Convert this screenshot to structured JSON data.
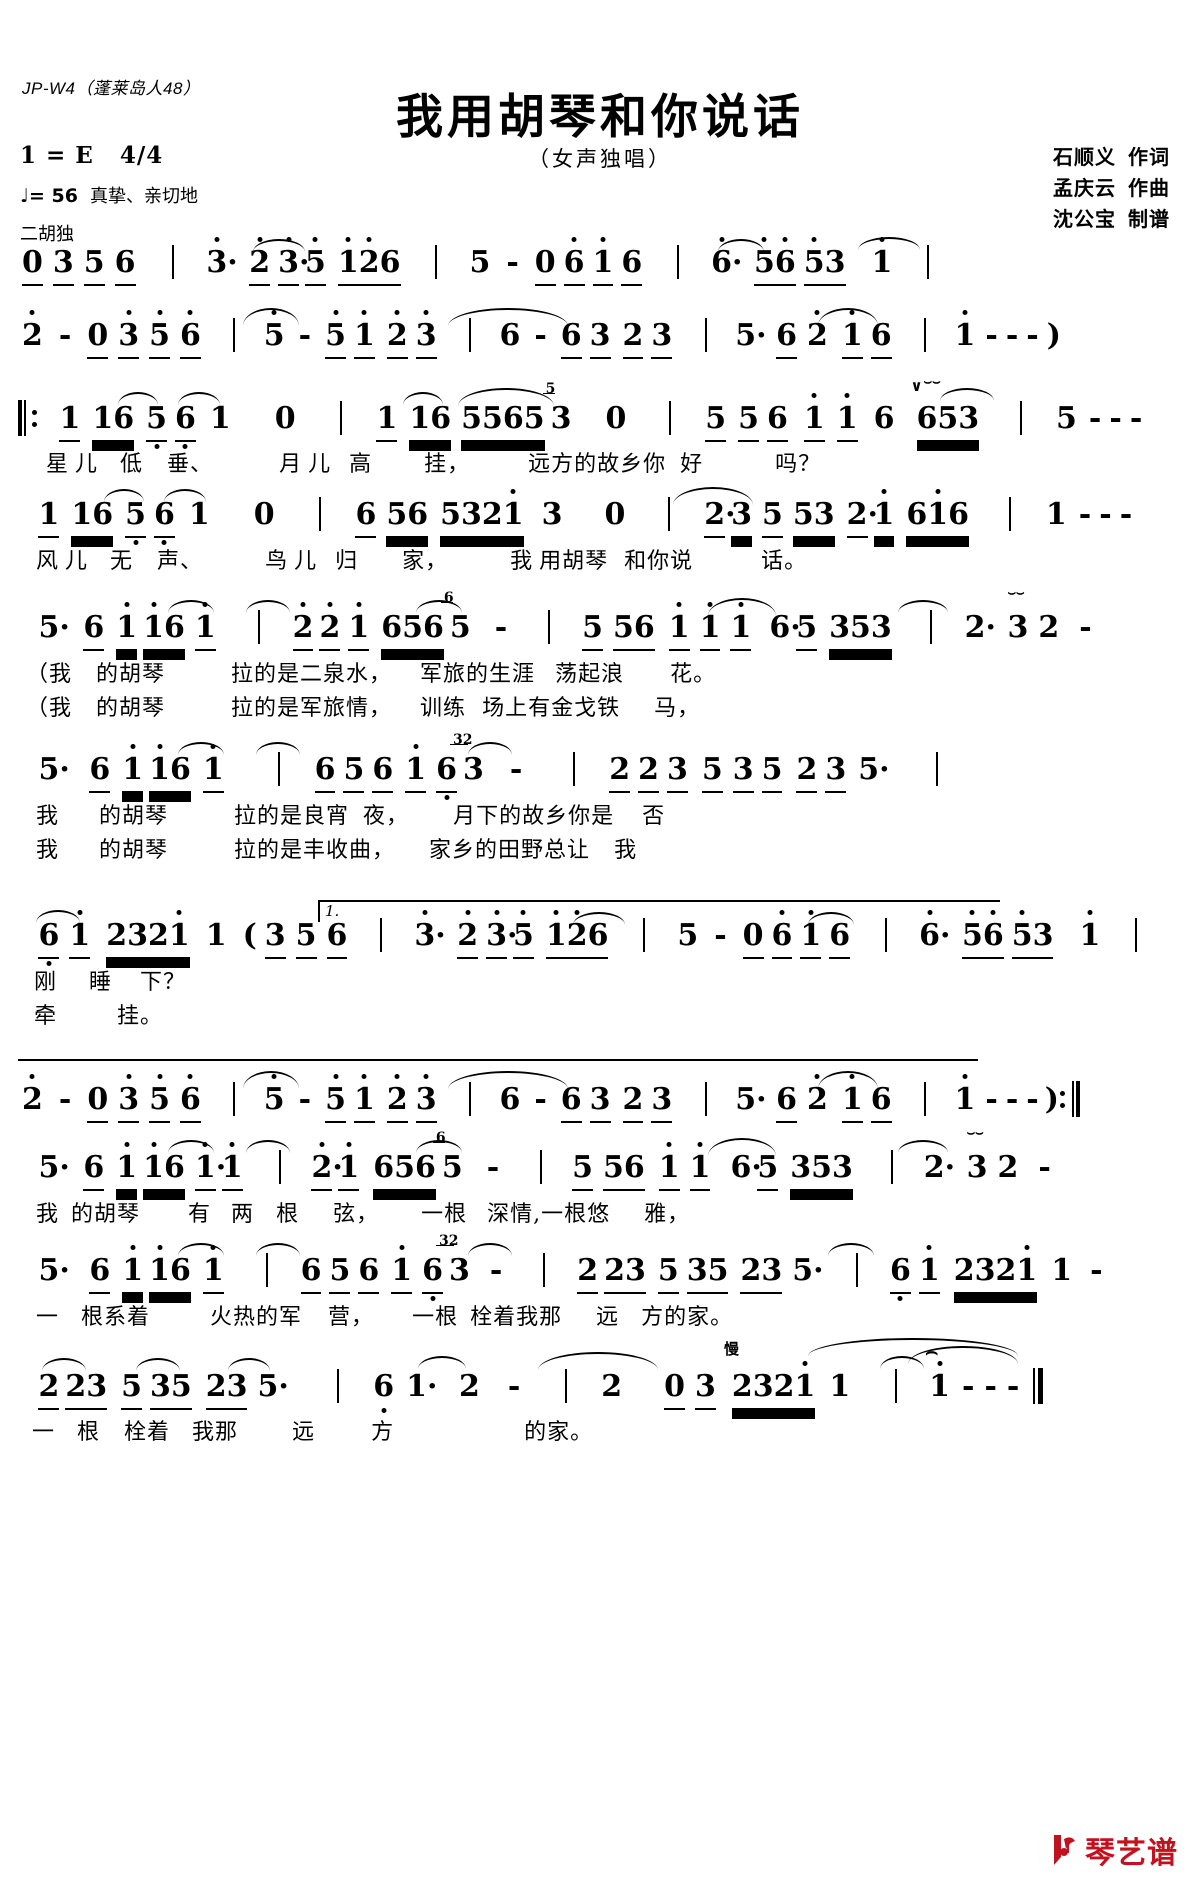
{
  "header": {
    "catalog": "JP-W4（蓬莱岛人48）",
    "title": "我用胡琴和你说话",
    "subtitle": "（女声独唱）",
    "key_label": "1 = E",
    "meter": "4/4",
    "tempo_value": "= 56",
    "tempo_note_glyph": "♩",
    "mood": "真挚、亲切地",
    "instrument_cue": "二胡独",
    "credits": [
      {
        "name": "石顺义",
        "role": "作词"
      },
      {
        "name": "孟庆云",
        "role": "作曲"
      },
      {
        "name": "沈公宝",
        "role": "制谱"
      }
    ]
  },
  "footer": {
    "logo_text": "琴艺谱",
    "logo_color": "#c1121f"
  },
  "chart_data": {
    "type": "table",
    "title": "我用胡琴和你说话 — 简谱 (jianpu numbered notation)",
    "key": "1 = E",
    "time_signature": "4/4",
    "tempo_bpm": 56,
    "voice": "女声独唱",
    "systems": [
      {
        "id": "intro-1",
        "label": "二胡独 (erhu solo intro)",
        "measures": [
          "0 3 5 6",
          "3· 2 3·5 1 2 6",
          "5 - 0 6 1 6",
          "6· 5 6 5 3  1"
        ],
        "lyrics": []
      },
      {
        "id": "intro-2",
        "measures": [
          "2 - 0 3 5 6",
          "5 - 5 1 2 3",
          "6 - 6 3 2 3",
          "5· 6 2 1 6",
          "1 - - - )"
        ],
        "lyrics": []
      },
      {
        "id": "verse-1a",
        "repeat_open": true,
        "measures": [
          "1 1 6 5 6 1  0",
          "1 1 6 5 5 6 5 (5)3  0",
          "5 5 6 1 1 6  6 5 3",
          "5 - - -"
        ],
        "lyrics": [
          "星儿 低 垂、 月儿 高 挂， 远方的故乡你 好 吗？"
        ]
      },
      {
        "id": "verse-1b",
        "measures": [
          "1 1 6 5 6 1  0",
          "6 5 6 5 3 2 1  3  0",
          "2·3 5 5 3 2·1 6 1 6",
          "1 - - -"
        ],
        "lyrics": [
          "风儿 无 声、 鸟儿 归 家， 我用胡琴 和你说 话。"
        ]
      },
      {
        "id": "verse-2",
        "measures": [
          "5· 6 1 1 6 1",
          "2 2 1 6 5 6 (6)5 -",
          "5 5 6 1 1 1 6·5 3 5 3",
          "2· 3 2 -"
        ],
        "lyrics": [
          "我 的胡琴 拉的是二泉水， 军旅的生涯 荡起浪 花。",
          "我 的胡琴 拉的是军旅情， 训练 场上有金戈铁 马，"
        ]
      },
      {
        "id": "verse-3",
        "measures": [
          "5· 6 1 1 6 1",
          "6 5 6 1 6 (32)3 -",
          "2 2 3 5 3 5 2 3 5·"
        ],
        "lyrics": [
          "我 的胡琴 拉的是良宵 夜， 月下的故乡你是 否",
          "我 的胡琴 拉的是丰收曲， 家乡的田野总让 我"
        ]
      },
      {
        "id": "verse-4-volta1",
        "volta": "1.",
        "measures": [
          "6 1 2 3 2 1 1 ( 3 5 6",
          "3· 2 3·5 1 2 6",
          "5 - 0 6 1 6",
          "6· 5 6 5 3  1"
        ],
        "lyrics": [
          "刚 睡 下？",
          "牵 挂。"
        ]
      },
      {
        "id": "volta1-end",
        "measures": [
          "2 - 0 3 5 6",
          "5 - 5 1 2 3",
          "6 - 6 3 2 3",
          "5· 6 2 1 6",
          "1 - - - )"
        ],
        "repeat_close": true,
        "lyrics": []
      },
      {
        "id": "chorus-1",
        "measures": [
          "5· 6 1 1 6 1·1",
          "2·1 6 5 6 (6)5 -",
          "5 5 6 1 1 6·5 3 5 3",
          "2· 3 2 -"
        ],
        "lyrics": [
          "我 的胡琴 有 两 根 弦， 一根 深情，一根悠 雅，"
        ]
      },
      {
        "id": "chorus-2",
        "measures": [
          "5· 6 1 1 6 1",
          "6 5 6 1 6 (32)3 -",
          "2 2 3 5 3 5 2 3 5·",
          "6 1 2 3 2 1 1 -"
        ],
        "lyrics": [
          "一 根系着 火热的军 营， 一根 栓着我那 远 方的家。"
        ]
      },
      {
        "id": "chorus-3",
        "tempo_change": "慢",
        "measures": [
          "2 2 3 5 3 5 2 3 5·",
          "6 1· 2 -",
          "2  0 3 2 3 2 1 1",
          "1 - - -"
        ],
        "lyrics": [
          "一 根 栓着 我那 远 方 的家。"
        ]
      }
    ]
  }
}
